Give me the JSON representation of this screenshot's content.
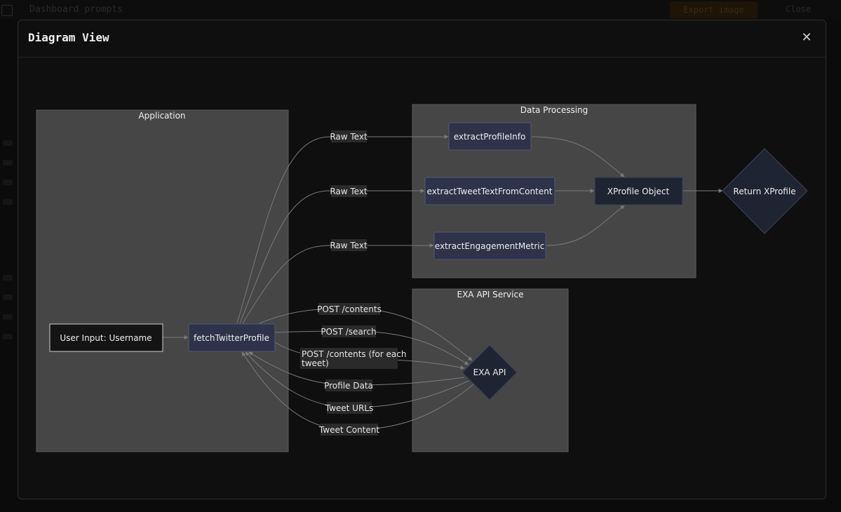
{
  "background": {
    "app_title": "Dashboard prompts",
    "export_label": "Export image",
    "user_label": "Close"
  },
  "modal": {
    "title": "Diagram View",
    "close_glyph": "✕"
  },
  "diagram": {
    "clusters": {
      "application": "Application",
      "data_processing": "Data Processing",
      "exa_service": "EXA API Service"
    },
    "nodes": {
      "user_input": "User Input: Username",
      "fetch": "fetchTwitterProfile",
      "extract_profile": "extractProfileInfo",
      "extract_tweet": "extractTweetTextFromContent",
      "extract_engagement": "extractEngagementMetric",
      "xprofile": "XProfile Object",
      "return": "Return XProfile",
      "exa_api": "EXA API"
    },
    "edge_labels": {
      "raw1": "Raw Text",
      "raw2": "Raw Text",
      "raw3": "Raw Text",
      "post_contents": "POST /contents",
      "post_search": "POST /search",
      "post_each_1": "POST /contents (for each",
      "post_each_2": "tweet)",
      "profile_data": "Profile Data",
      "tweet_urls": "Tweet URLs",
      "tweet_content": "Tweet Content"
    },
    "colors": {
      "node_fill": "#2e3349",
      "cluster_fill": "#464646",
      "edge": "#7a7a7a"
    }
  }
}
